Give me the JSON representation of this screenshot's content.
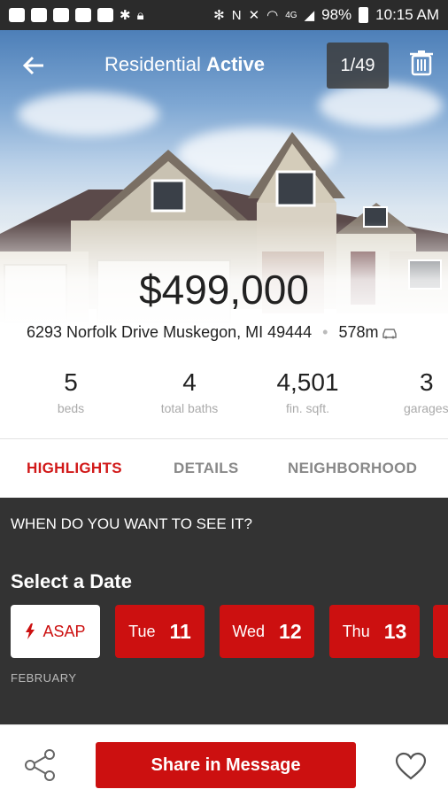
{
  "status_bar": {
    "battery": "98%",
    "time": "10:15 AM",
    "network": "4G"
  },
  "header": {
    "title_type": "Residential",
    "title_status": "Active",
    "photo_counter": "1/49"
  },
  "listing": {
    "price": "$499,000",
    "address": "6293 Norfolk Drive Muskegon, MI 49444",
    "distance": "578m"
  },
  "stats": [
    {
      "value": "5",
      "label": "beds"
    },
    {
      "value": "4",
      "label": "total baths"
    },
    {
      "value": "4,501",
      "label": "fin. sqft."
    },
    {
      "value": "3",
      "label": "garages"
    }
  ],
  "tabs": [
    {
      "label": "HIGHLIGHTS",
      "active": true
    },
    {
      "label": "DETAILS",
      "active": false
    },
    {
      "label": "NEIGHBORHOOD",
      "active": false
    }
  ],
  "schedule": {
    "question": "WHEN DO YOU WANT TO SEE IT?",
    "select_label": "Select a Date",
    "asap_label": "ASAP",
    "dates": [
      {
        "day": "Tue",
        "num": "11"
      },
      {
        "day": "Wed",
        "num": "12"
      },
      {
        "day": "Thu",
        "num": "13"
      }
    ],
    "month": "FEBRUARY"
  },
  "bottom": {
    "share_label": "Share in Message"
  },
  "colors": {
    "accent": "#cc1010",
    "dark_section": "#333333"
  }
}
